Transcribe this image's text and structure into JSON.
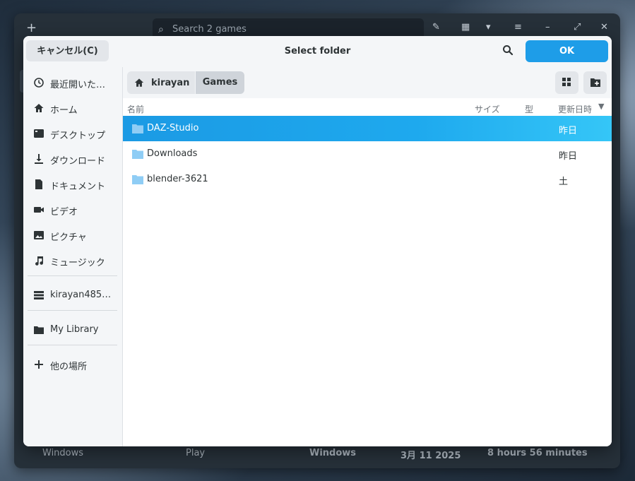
{
  "app": {
    "search_placeholder": "Search 2 games",
    "bottom": {
      "platform": "Windows",
      "play_label": "Play",
      "left_label": "Windows",
      "date": "3月 11 2025",
      "playtime": "8 hours 56 minutes"
    }
  },
  "dialog": {
    "title": "Select folder",
    "cancel_label": "キャンセル(C)",
    "ok_label": "OK"
  },
  "sidebar": {
    "items": [
      {
        "label": "最近開いた…",
        "icon": "recent-icon"
      },
      {
        "label": "ホーム",
        "icon": "home-icon"
      },
      {
        "label": "デスクトップ",
        "icon": "desktop-icon"
      },
      {
        "label": "ダウンロード",
        "icon": "download-icon"
      },
      {
        "label": "ドキュメント",
        "icon": "document-icon"
      },
      {
        "label": "ビデオ",
        "icon": "video-icon"
      },
      {
        "label": "ピクチャ",
        "icon": "picture-icon"
      },
      {
        "label": "ミュージック",
        "icon": "music-icon"
      },
      {
        "label": "kirayan485…",
        "icon": "drive-icon"
      },
      {
        "label": "My Library",
        "icon": "folder-icon"
      },
      {
        "label": "他の場所",
        "icon": "plus-icon"
      }
    ]
  },
  "pathbar": {
    "crumbs": [
      "kirayan",
      "Games"
    ]
  },
  "columns": {
    "name": "名前",
    "size": "サイズ",
    "type": "型",
    "modified": "更新日時"
  },
  "files": [
    {
      "name": "DAZ-Studio",
      "modified": "昨日",
      "selected": true
    },
    {
      "name": "Downloads",
      "modified": "昨日",
      "selected": false
    },
    {
      "name": "blender-3621",
      "modified": "土",
      "selected": false
    }
  ],
  "colors": {
    "accent": "#1e9de8",
    "folder": "#8fcdf5"
  }
}
